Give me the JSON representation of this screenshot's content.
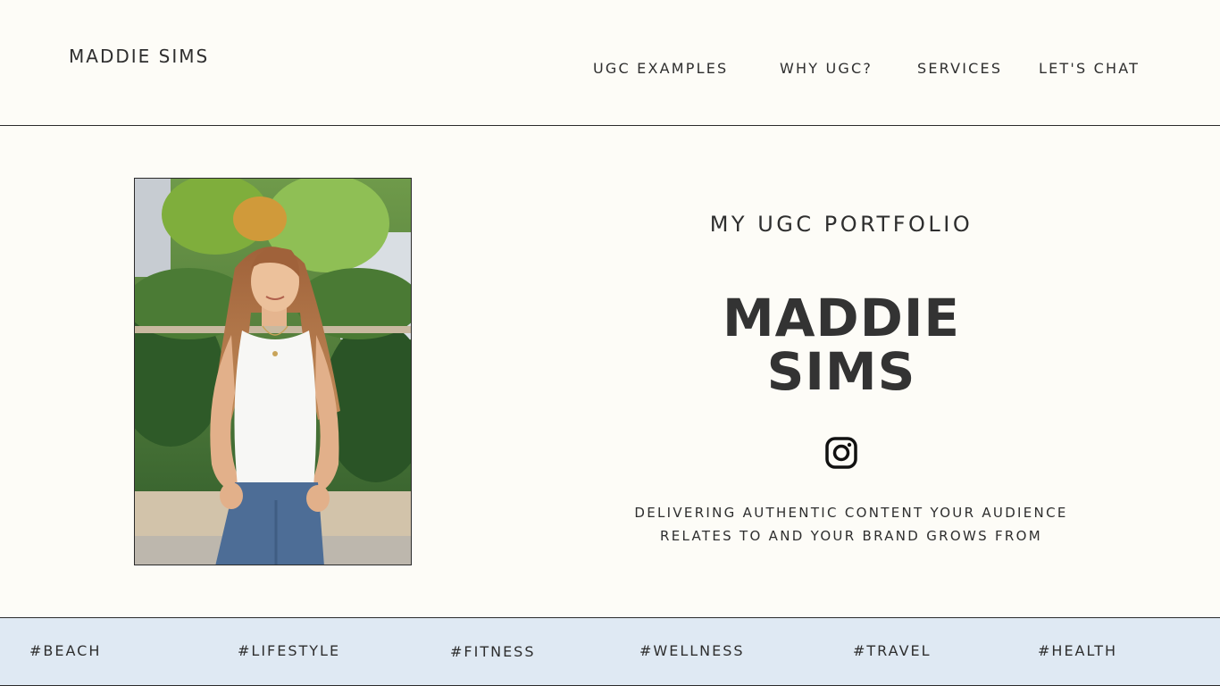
{
  "header": {
    "brand": "MADDIE SIMS",
    "nav": [
      {
        "label": "UGC EXAMPLES"
      },
      {
        "label": "WHY UGC?"
      },
      {
        "label": "SERVICES"
      },
      {
        "label": "LET'S CHAT"
      }
    ]
  },
  "hero": {
    "eyebrow": "MY UGC PORTFOLIO",
    "name_line1": "MADDIE",
    "name_line2": "SIMS",
    "social_icon": "instagram-icon",
    "tagline_line1": "DELIVERING AUTHENTIC CONTENT YOUR AUDIENCE",
    "tagline_line2": "RELATES TO AND YOUR BRAND GROWS FROM"
  },
  "tags": [
    "#BEACH",
    "#LIFESTYLE",
    "#FITNESS",
    "#WELLNESS",
    "#TRAVEL",
    "#HEALTH"
  ],
  "colors": {
    "background": "#fdfcf7",
    "text": "#333333",
    "band": "#dfe9f3",
    "rule": "#2b2b2b"
  }
}
